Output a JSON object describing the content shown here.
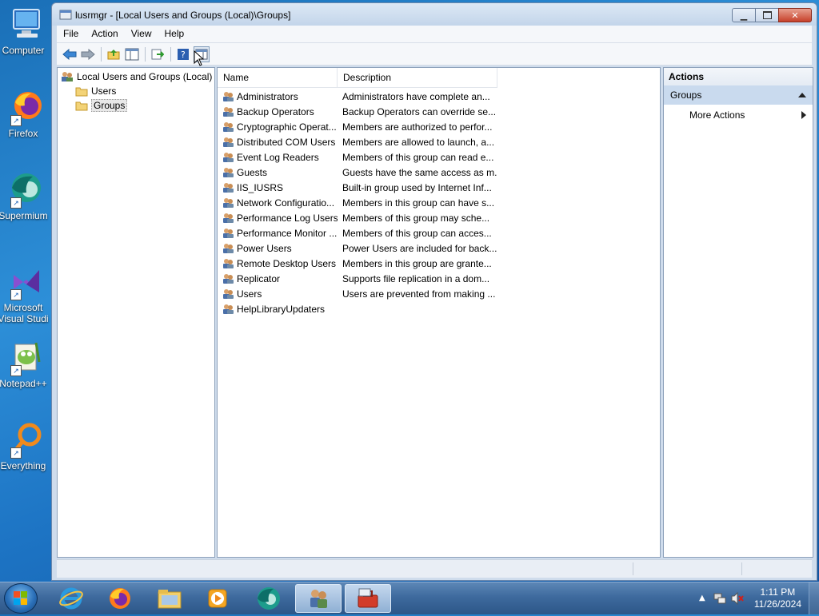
{
  "desktop": {
    "icons": [
      {
        "label": "Computer",
        "icon": "computer-icon"
      },
      {
        "label": "Firefox",
        "icon": "firefox-icon"
      },
      {
        "label": "Supermium",
        "icon": "supermium-icon"
      },
      {
        "label": "Microsoft Visual Studio",
        "line1": "Microsoft",
        "line2": "Visual Studi",
        "icon": "visual-studio-icon"
      },
      {
        "label": "Notepad++",
        "icon": "notepad-plus-plus-icon"
      },
      {
        "label": "Everything",
        "icon": "everything-search-icon"
      }
    ]
  },
  "window": {
    "title": "lusrmgr - [Local Users and Groups (Local)\\Groups]",
    "menu": [
      "File",
      "Action",
      "View",
      "Help"
    ],
    "toolbar": [
      "back-icon",
      "forward-icon",
      "up-folder-icon",
      "show-hide-tree-icon",
      "export-list-icon",
      "help-icon",
      "show-hide-action-pane-icon"
    ]
  },
  "tree": {
    "root": "Local Users and Groups (Local)",
    "children": [
      "Users",
      "Groups"
    ],
    "selected": "Groups"
  },
  "list": {
    "columns": [
      "Name",
      "Description"
    ],
    "rows": [
      {
        "name": "Administrators",
        "description": "Administrators have complete an..."
      },
      {
        "name": "Backup Operators",
        "description": "Backup Operators can override se..."
      },
      {
        "name": "Cryptographic Operat...",
        "description": "Members are authorized to perfor..."
      },
      {
        "name": "Distributed COM Users",
        "description": "Members are allowed to launch, a..."
      },
      {
        "name": "Event Log Readers",
        "description": "Members of this group can read e..."
      },
      {
        "name": "Guests",
        "description": "Guests have the same access as m..."
      },
      {
        "name": "IIS_IUSRS",
        "description": "Built-in group used by Internet Inf..."
      },
      {
        "name": "Network Configuratio...",
        "description": "Members in this group can have s..."
      },
      {
        "name": "Performance Log Users",
        "description": "Members of this group may sche..."
      },
      {
        "name": "Performance Monitor ...",
        "description": "Members of this group can acces..."
      },
      {
        "name": "Power Users",
        "description": "Power Users are included for back..."
      },
      {
        "name": "Remote Desktop Users",
        "description": "Members in this group are grante..."
      },
      {
        "name": "Replicator",
        "description": "Supports file replication in a dom..."
      },
      {
        "name": "Users",
        "description": "Users are prevented from making ..."
      },
      {
        "name": "HelpLibraryUpdaters",
        "description": ""
      }
    ]
  },
  "actions": {
    "header": "Actions",
    "group": "Groups",
    "more": "More Actions"
  },
  "taskbar": {
    "pinned": [
      "internet-explorer-icon",
      "firefox-icon",
      "file-explorer-icon",
      "media-player-icon",
      "supermium-icon",
      "lusrmgr-users-icon",
      "computer-management-toolbox-icon"
    ],
    "active_index": 5,
    "clock_time": "1:11 PM",
    "clock_date": "11/26/2024"
  }
}
